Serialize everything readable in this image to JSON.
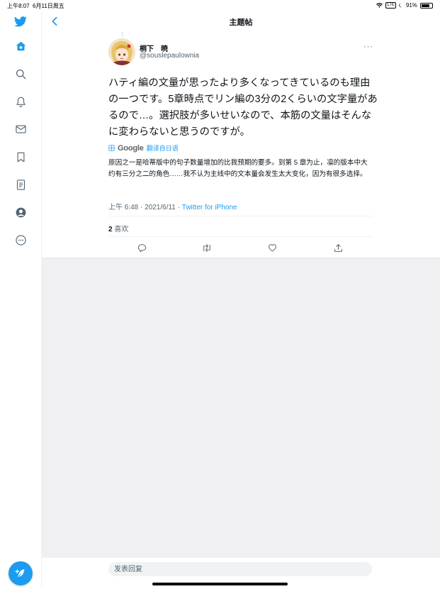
{
  "status_bar": {
    "time": "上午8:07",
    "date": "6月11日周五",
    "network": "LTE",
    "battery": "91%",
    "battery_level": 0.91
  },
  "sidebar": {
    "items": [
      {
        "icon": "twitter-bird-icon",
        "active": true
      },
      {
        "icon": "home-icon",
        "active": true
      },
      {
        "icon": "search-icon"
      },
      {
        "icon": "notifications-bell-icon"
      },
      {
        "icon": "messages-envelope-icon"
      },
      {
        "icon": "bookmarks-icon"
      },
      {
        "icon": "lists-icon"
      },
      {
        "icon": "profile-icon"
      },
      {
        "icon": "more-options-icon"
      }
    ],
    "compose_icon": "compose-feather-icon"
  },
  "header": {
    "title": "主题帖",
    "back_icon": "back-chevron-icon"
  },
  "tweet": {
    "author_name": "桐下　暁",
    "author_handle": "@souslepaulownia",
    "more_label": "···",
    "text": "ハティ編の文量が思ったより多くなってきているのも理由の一つです。5章時点でリン編の3分の2くらいの文字量があるので…。選択肢が多いせいなので、本筋の文量はそんなに変わらないと思うのですが。",
    "translation": {
      "google_label": "Google",
      "label": "翻译自日语",
      "text": "原因之一是哈蒂版中的句子数量增加的比我预期的要多。到第 5 章为止，凛的版本中大约有三分之二的角色……我不认为主线中的文本量会发生太大变化，因为有很多选择。"
    },
    "timestamp": "上午 6:48 · 2021/6/11 · ",
    "source": "Twitter for iPhone",
    "likes_count": "2",
    "likes_label": "喜欢",
    "actions": [
      "reply-icon",
      "retweet-icon",
      "like-heart-icon",
      "share-icon"
    ]
  },
  "reply_bar": {
    "placeholder": "发表回复"
  },
  "colors": {
    "accent": "#1d9bf0",
    "text": "#0f1419",
    "secondary_text": "#536471",
    "background_gray": "#f0f0f3"
  }
}
